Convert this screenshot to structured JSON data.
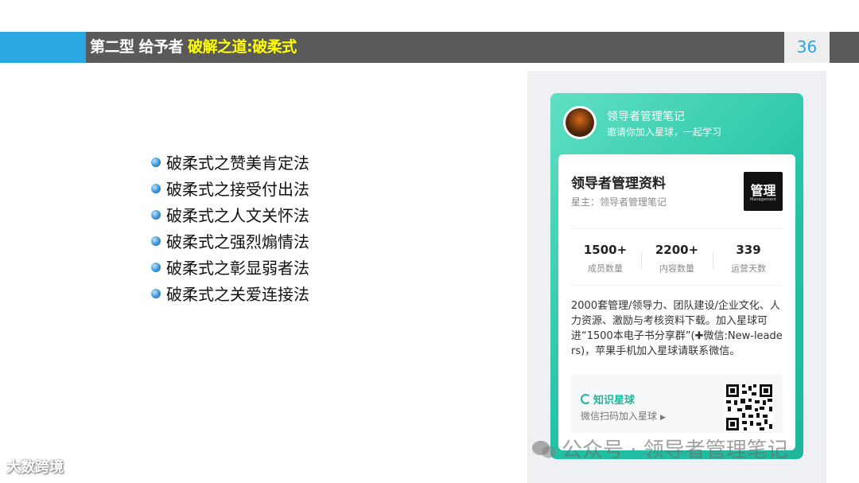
{
  "header": {
    "title": "第二型 给予者",
    "subtitle": "破解之道:破柔式",
    "page_number": "36",
    "colors": {
      "accent_blue": "#2aa6e0",
      "bar_gray": "#5a5a5a",
      "subtitle_yellow": "#ffff00"
    }
  },
  "bullets": [
    {
      "text": "破柔式之赞美肯定法"
    },
    {
      "text": "破柔式之接受付出法"
    },
    {
      "text": "破柔式之人文关怀法"
    },
    {
      "text": "破柔式之强烈煽情法"
    },
    {
      "text": "破柔式之彰显弱者法"
    },
    {
      "text": "破柔式之关爱连接法"
    }
  ],
  "card": {
    "name": "领导者管理笔记",
    "invite": "邀请你加入星球，一起学习",
    "resource_title": "领导者管理资料",
    "owner": "星主：领导者管理笔记",
    "logo_main": "管理",
    "logo_sub": "Management",
    "stats": [
      {
        "value": "1500+",
        "label": "成员数量"
      },
      {
        "value": "2200+",
        "label": "内容数量"
      },
      {
        "value": "339",
        "label": "运营天数"
      }
    ],
    "description": "2000套管理/领导力、团队建设/企业文化、人力资源、激励与考核资料下载。加入星球可进“1500本电子书分享群”(✚微信:New-leaders)，苹果手机加入星球请联系微信。",
    "planet_label": "知识星球",
    "scan_label": "微信扫码加入星球",
    "theme_color": "#1fb79d"
  },
  "watermark": "公众号 · 领导者管理笔记",
  "corner_logo": "大数跨境"
}
